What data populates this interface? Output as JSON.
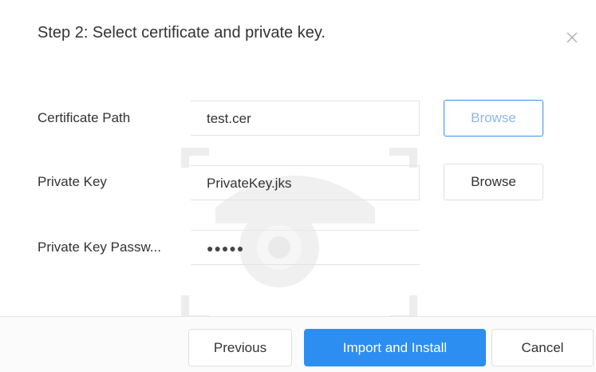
{
  "dialog": {
    "title": "Step 2: Select certificate and private key.",
    "close_icon": "close-icon"
  },
  "form": {
    "certificate": {
      "label": "Certificate Path",
      "value": "test.cer",
      "browse_label": "Browse"
    },
    "private_key": {
      "label": "Private Key",
      "value": "PrivateKey.jks",
      "browse_label": "Browse"
    },
    "password": {
      "label": "Private Key Passw...",
      "value": "●●●●●"
    }
  },
  "footer": {
    "previous_label": "Previous",
    "import_label": "Import and Install",
    "cancel_label": "Cancel"
  },
  "colors": {
    "primary": "#2b8ef0",
    "focus_border": "#3a8ee6"
  }
}
